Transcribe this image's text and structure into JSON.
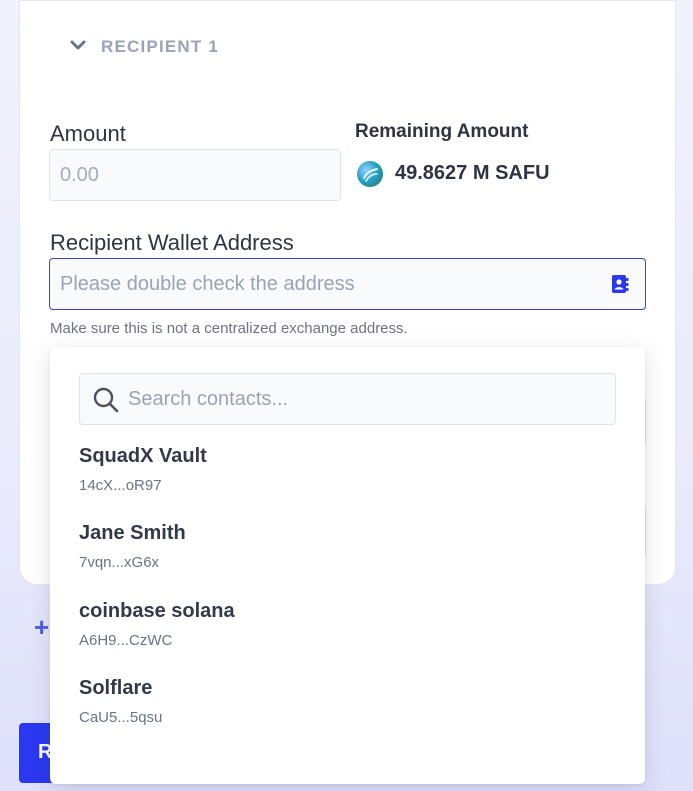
{
  "recipient": {
    "title": "RECIPIENT 1",
    "amount_label": "Amount",
    "amount_placeholder": "0.00",
    "remaining_label": "Remaining Amount",
    "remaining_value": "49.8627 M SAFU",
    "address_label": "Recipient Wallet Address",
    "address_placeholder": "Please double check the address",
    "hint": "Make sure this is not a centralized exchange address."
  },
  "contacts": {
    "search_placeholder": "Search contacts...",
    "items": [
      {
        "name": "SquadX Vault",
        "address": "14cX...oR97"
      },
      {
        "name": "Jane Smith",
        "address": "7vqn...xG6x"
      },
      {
        "name": "coinbase solana",
        "address": "A6H9...CzWC"
      },
      {
        "name": "Solflare",
        "address": "CaU5...5qsu"
      }
    ]
  },
  "partial": {
    "add_symbol": "+",
    "button_letter": "R"
  },
  "colors": {
    "accent": "#3b3ed0",
    "button": "#2a39f0",
    "muted": "#9aa3b6"
  }
}
